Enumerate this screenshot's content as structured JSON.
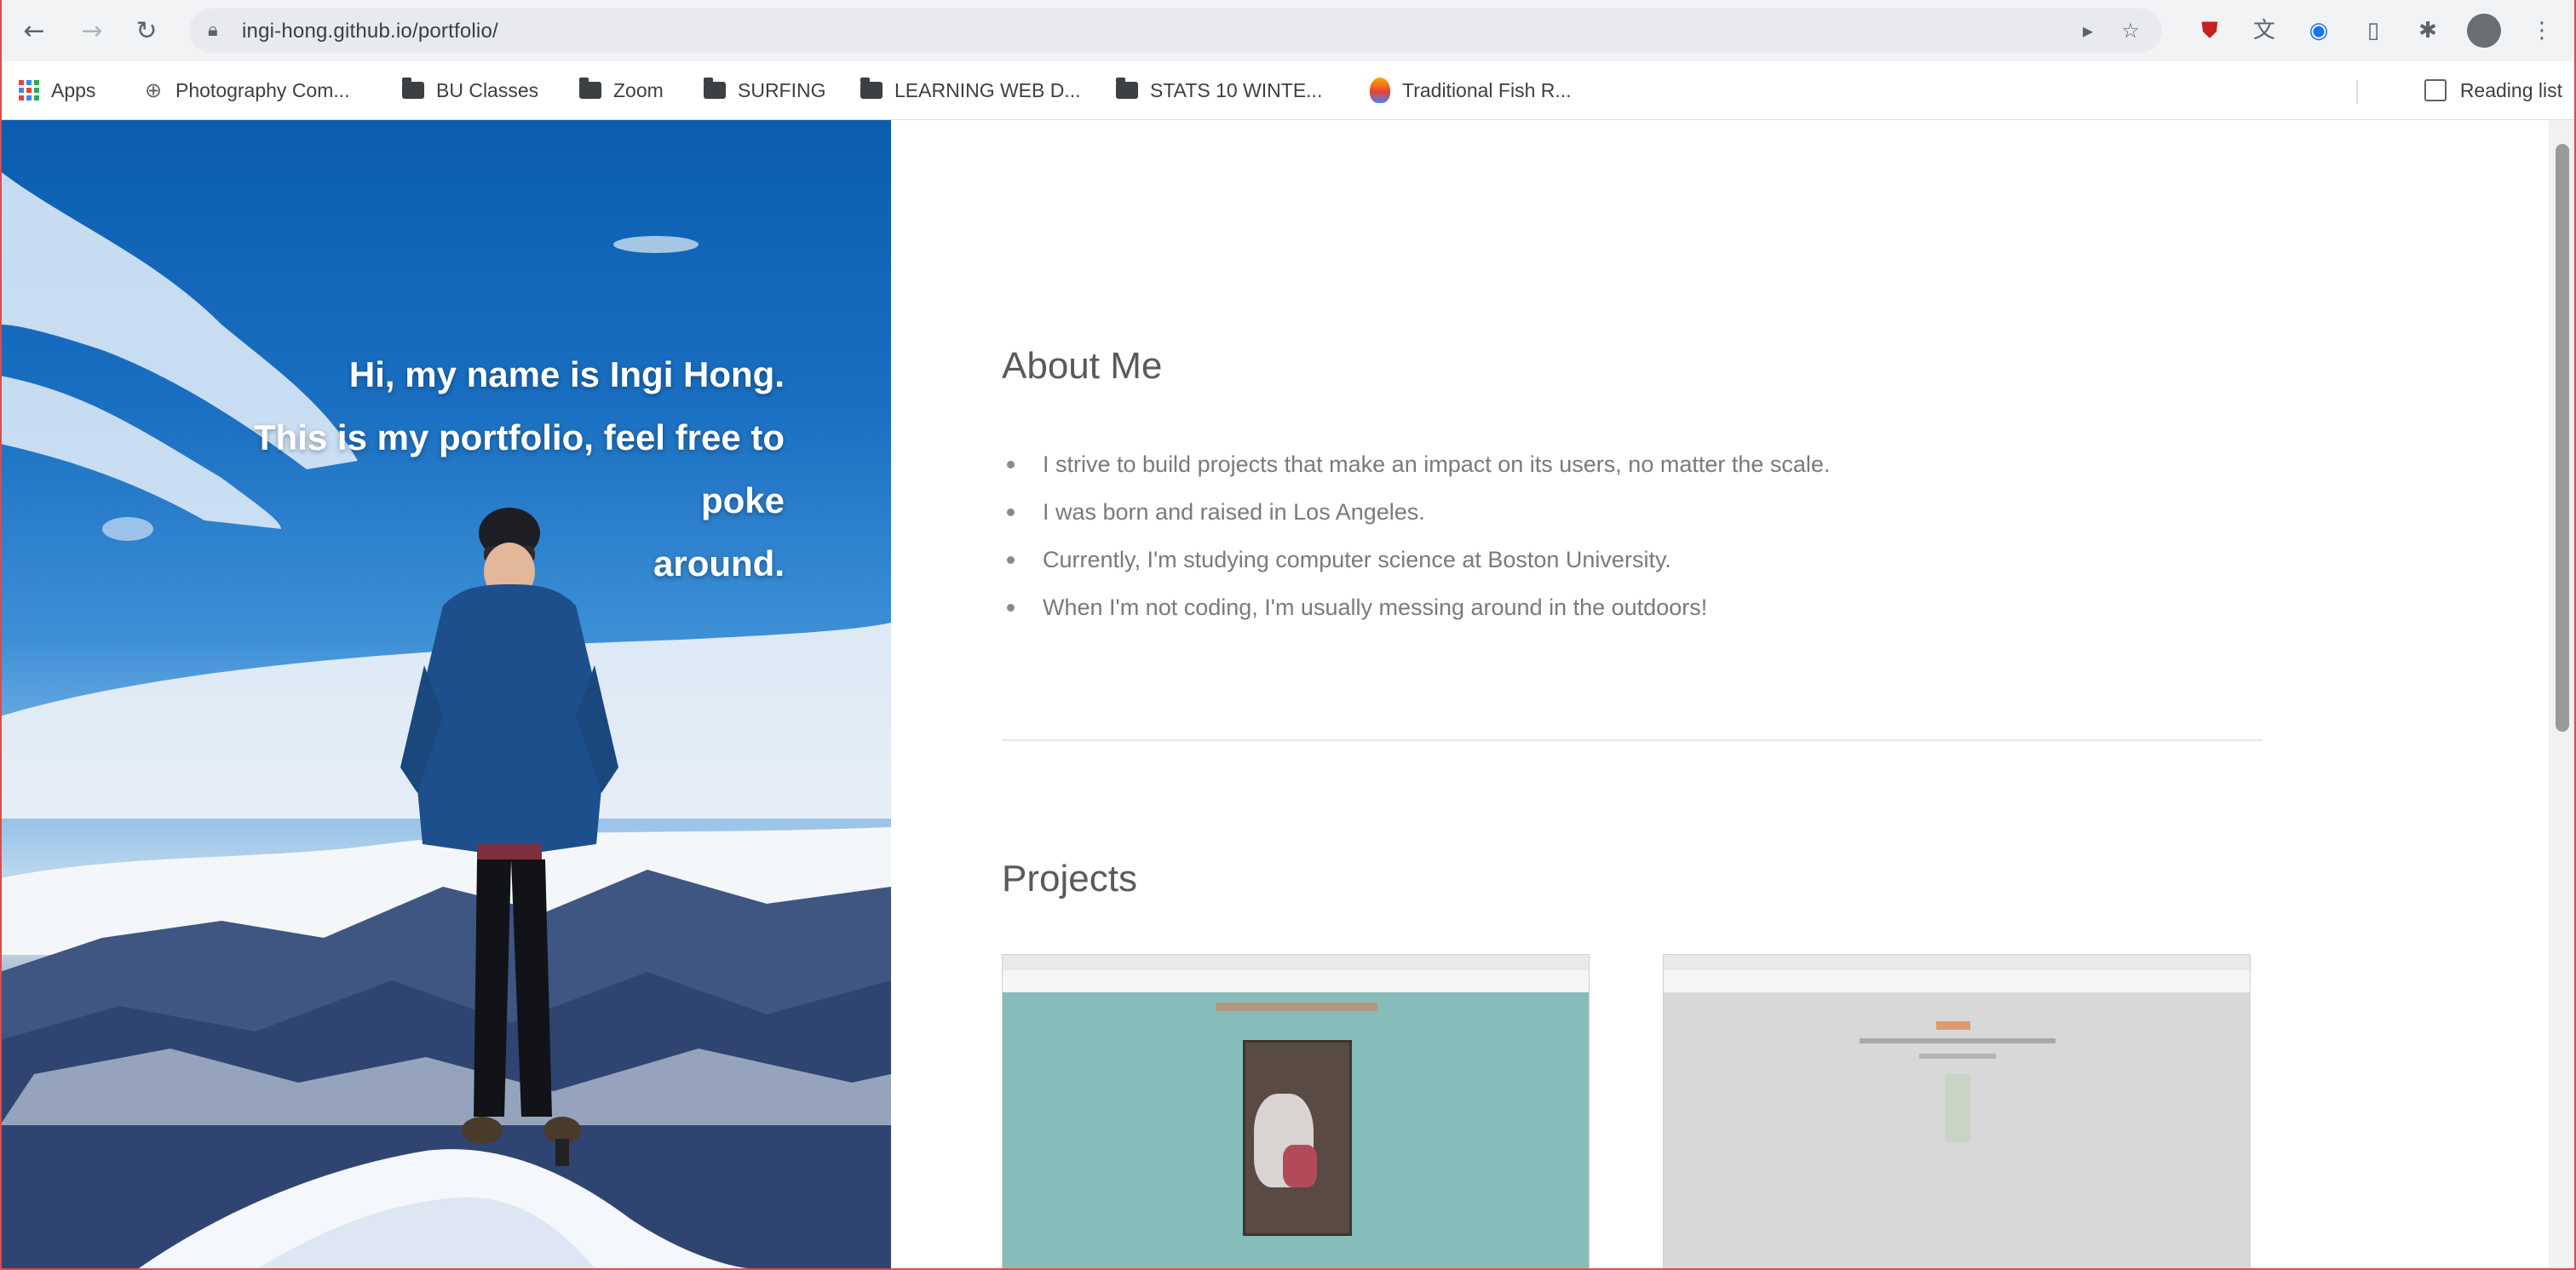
{
  "browser": {
    "url": "ingi-hong.github.io/portfolio/",
    "back_icon": "arrow-left-icon",
    "forward_icon": "arrow-right-icon",
    "reload_icon": "reload-icon",
    "lock_icon": "lock-icon"
  },
  "bookmarks": {
    "items": [
      {
        "label": "Apps",
        "icon": "apps-grid-icon"
      },
      {
        "label": "Photography Com...",
        "icon": "globe-icon"
      },
      {
        "label": "BU Classes",
        "icon": "folder-icon"
      },
      {
        "label": "Zoom",
        "icon": "folder-icon"
      },
      {
        "label": "SURFING",
        "icon": "folder-icon"
      },
      {
        "label": "LEARNING WEB D...",
        "icon": "folder-icon"
      },
      {
        "label": "STATS 10 WINTE...",
        "icon": "folder-icon"
      },
      {
        "label": "Traditional Fish R...",
        "icon": "flame-icon"
      }
    ],
    "reading_list": "Reading list"
  },
  "hero": {
    "line1": "Hi, my name is Ingi Hong.",
    "line2": "This is my portfolio, feel free to poke",
    "line3": "around."
  },
  "about": {
    "title": "About Me",
    "items": [
      "I strive to build projects that make an impact on its users, no matter the scale.",
      "I was born and raised in Los Angeles.",
      "Currently, I'm studying computer science at Boston University.",
      "When I'm not coding, I'm usually messing around in the outdoors!"
    ]
  },
  "projects": {
    "title": "Projects"
  },
  "colors": {
    "chrome_bg": "#f1f3f4",
    "sky_blue": "#1a6fc2",
    "project1_bg": "#86bdbb",
    "project2_bg": "#d8d8d8"
  }
}
